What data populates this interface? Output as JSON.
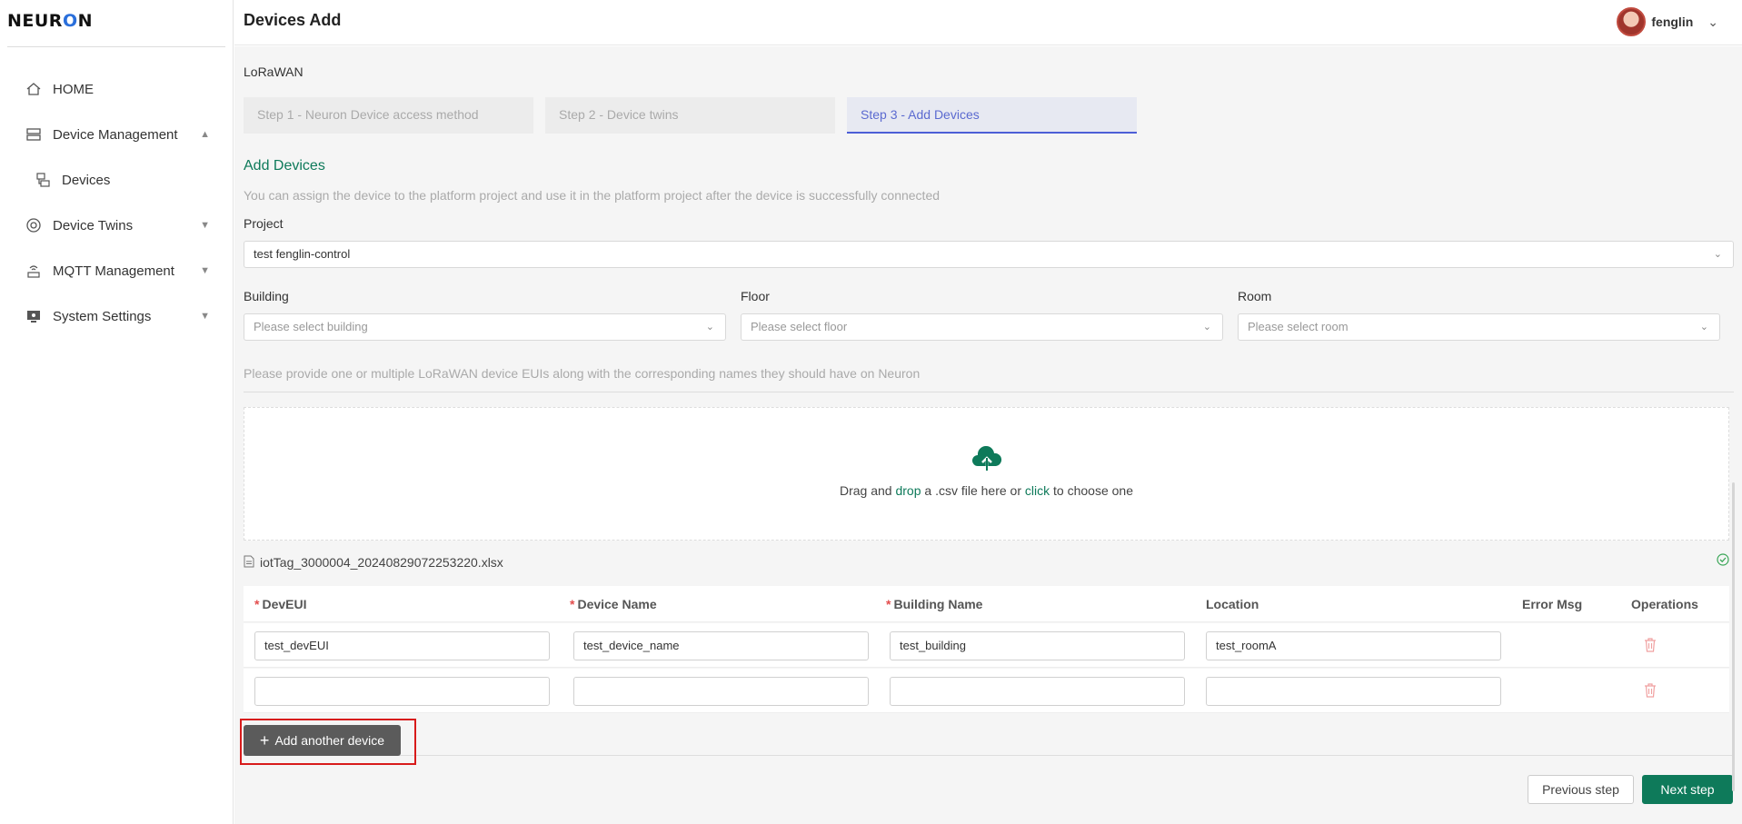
{
  "app": {
    "logo": "NEURON"
  },
  "header": {
    "title": "Devices Add",
    "username": "fenglin"
  },
  "sidebar": {
    "items": [
      {
        "label": "HOME",
        "icon": "home-icon"
      },
      {
        "label": "Device Management",
        "icon": "server-icon",
        "expanded": true
      },
      {
        "label": "Devices",
        "icon": "devices-icon",
        "sub": true
      },
      {
        "label": "Device Twins",
        "icon": "twins-icon"
      },
      {
        "label": "MQTT Management",
        "icon": "wifi-router-icon"
      },
      {
        "label": "System Settings",
        "icon": "monitor-icon"
      }
    ]
  },
  "main": {
    "protocol": "LoRaWAN",
    "steps": [
      "Step 1 - Neuron Device access method",
      "Step 2 - Device twins",
      "Step 3 - Add Devices"
    ],
    "active_step": 3,
    "section_title": "Add Devices",
    "section_desc": "You can assign the device to the platform project and use it in the platform project after the device is successfully connected",
    "project": {
      "label": "Project",
      "value": "test fenglin-control"
    },
    "building": {
      "label": "Building",
      "placeholder": "Please select building"
    },
    "floor": {
      "label": "Floor",
      "placeholder": "Please select floor"
    },
    "room": {
      "label": "Room",
      "placeholder": "Please select room"
    },
    "hint": "Please provide one or multiple LoRaWAN device EUIs along with the corresponding names they should have on Neuron",
    "dropzone": {
      "t1": "Drag and ",
      "t2": "drop",
      "t3": " a .csv file here or ",
      "t4": "click",
      "t5": " to choose one"
    },
    "file_name": "iotTag_3000004_20240829072253220.xlsx",
    "table": {
      "headers": {
        "dev_eui": "DevEUI",
        "device_name": "Device Name",
        "building_name": "Building Name",
        "location": "Location",
        "error_msg": "Error Msg",
        "operations": "Operations"
      },
      "rows": [
        {
          "dev_eui": "test_devEUI",
          "device_name": "test_device_name",
          "building_name": "test_building",
          "location": "test_roomA"
        },
        {
          "dev_eui": "",
          "device_name": "",
          "building_name": "",
          "location": ""
        }
      ]
    },
    "add_button": "Add another device",
    "prev_button": "Previous step",
    "next_button": "Next step"
  },
  "colors": {
    "accent": "#0e7a5a",
    "step_active": "#4d5fd6",
    "required": "#e34d4d",
    "highlight": "#d81b1b"
  }
}
